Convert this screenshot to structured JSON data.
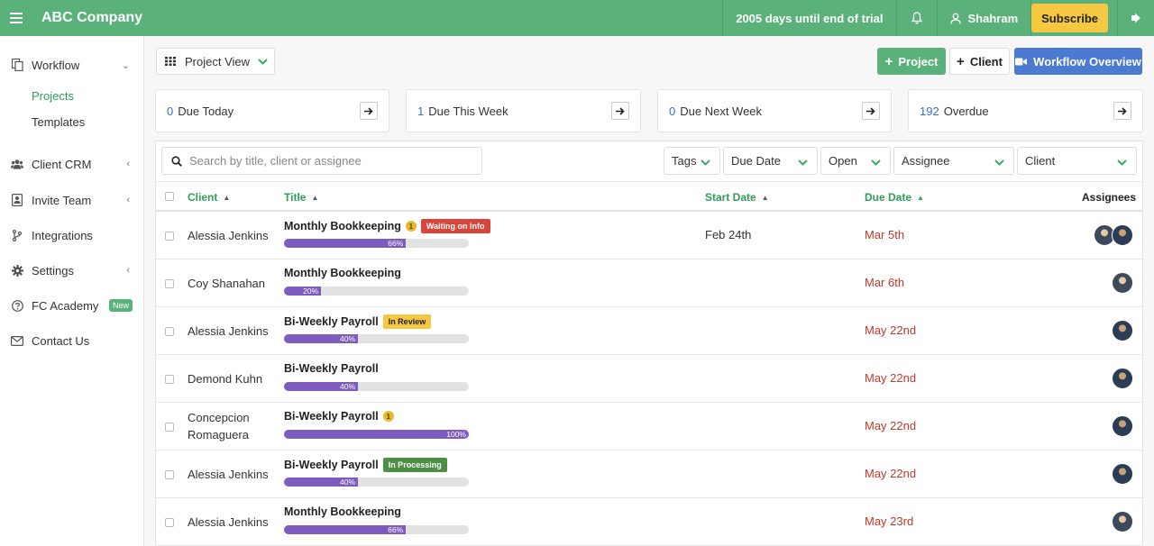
{
  "app": {
    "title": "ABC Company"
  },
  "topbar": {
    "trial": "2005 days until end of trial",
    "user": "Shahram",
    "subscribe": "Subscribe"
  },
  "sidebar": {
    "workflow": "Workflow",
    "projects": "Projects",
    "templates": "Templates",
    "client_crm": "Client CRM",
    "invite_team": "Invite Team",
    "integrations": "Integrations",
    "settings": "Settings",
    "fc_academy": "FC Academy",
    "new_badge": "New",
    "contact_us": "Contact Us"
  },
  "toolbar": {
    "view": "Project View",
    "project_btn": "Project",
    "client_btn": "Client",
    "overview_btn": "Workflow Overview"
  },
  "cards": [
    {
      "count": "0",
      "label": "Due Today"
    },
    {
      "count": "1",
      "label": "Due This Week"
    },
    {
      "count": "0",
      "label": "Due Next Week"
    },
    {
      "count": "192",
      "label": "Overdue"
    }
  ],
  "filters": {
    "search_placeholder": "Search by title, client or assignee",
    "tags": "Tags",
    "due_date": "Due Date",
    "open": "Open",
    "assignee": "Assignee",
    "client": "Client"
  },
  "table": {
    "headers": {
      "client": "Client",
      "title": "Title",
      "start": "Start Date",
      "due": "Due Date",
      "assignees": "Assignees"
    },
    "rows": [
      {
        "client": "Alessia Jenkins",
        "title": "Monthly Bookkeeping",
        "badge": "1",
        "status": "Waiting on Info",
        "progress": 66,
        "progress_label": "66%",
        "start": "Feb 24th",
        "due": "Mar 5th"
      },
      {
        "client": "Coy Shanahan",
        "title": "Monthly Bookkeeping",
        "badge": "",
        "status": "",
        "progress": 20,
        "progress_label": "20%",
        "start": "",
        "due": "Mar 6th"
      },
      {
        "client": "Alessia Jenkins",
        "title": "Bi-Weekly Payroll",
        "badge": "",
        "status": "In Review",
        "progress": 40,
        "progress_label": "40%",
        "start": "",
        "due": "May 22nd"
      },
      {
        "client": "Demond Kuhn",
        "title": "Bi-Weekly Payroll",
        "badge": "",
        "status": "",
        "progress": 40,
        "progress_label": "40%",
        "start": "",
        "due": "May 22nd"
      },
      {
        "client_line1": "Concepcion",
        "client_line2": "Romaguera",
        "title": "Bi-Weekly Payroll",
        "badge": "1",
        "status": "",
        "progress": 100,
        "progress_label": "100%",
        "start": "",
        "due": "May 22nd"
      },
      {
        "client": "Alessia Jenkins",
        "title": "Bi-Weekly Payroll",
        "badge": "",
        "status": "In Processing",
        "progress": 40,
        "progress_label": "40%",
        "start": "",
        "due": "May 22nd"
      },
      {
        "client": "Alessia Jenkins",
        "title": "Monthly Bookkeeping",
        "badge": "",
        "status": "",
        "progress": 66,
        "progress_label": "66%",
        "start": "",
        "due": "May 23rd"
      }
    ]
  },
  "colors": {
    "brand": "#5ab27a",
    "accent_blue": "#4a7bd0",
    "overdue_red": "#c0392b",
    "status_waiting": "#d9453a",
    "status_review": "#f5c842",
    "status_processing": "#4d8f45",
    "progress_fill": "#7e5bbf"
  }
}
